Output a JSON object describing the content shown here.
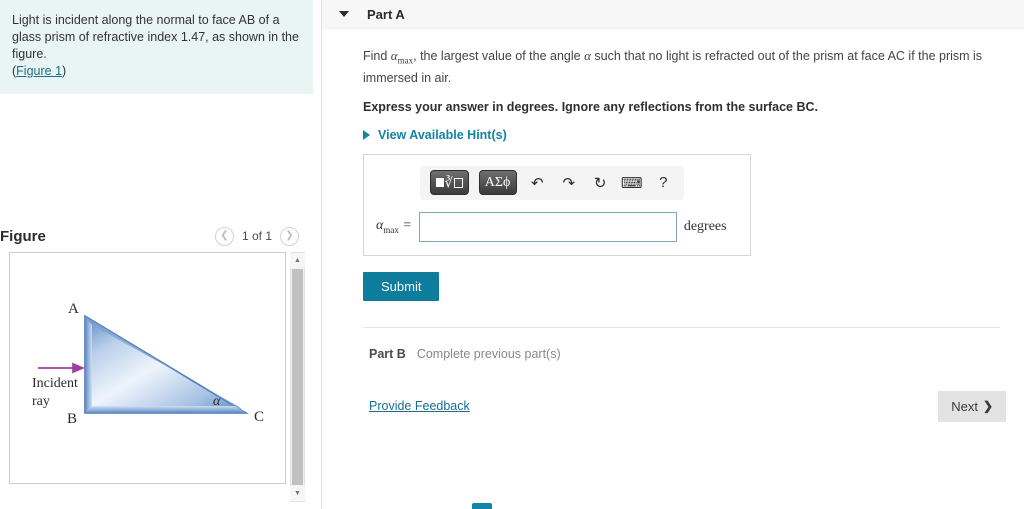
{
  "problem": {
    "text_line1": "Light is incident along the normal to face AB of a glass",
    "text_line2": "prism of refractive index 1.47, as shown in the figure.",
    "paren_open": "(",
    "figure_link": "Figure 1",
    "paren_close": ")"
  },
  "figure_panel": {
    "title": "Figure",
    "pager": {
      "prev_icon": "chevron-left-icon",
      "count_label": "1 of 1",
      "next_icon": "chevron-right-icon"
    },
    "scrollbar": {
      "up_icon": "triangle-up-icon",
      "down_icon": "triangle-down-icon"
    },
    "diagram": {
      "vertex_a": "A",
      "vertex_b": "B",
      "vertex_c": "C",
      "angle_label": "α",
      "ray_label_line1": "Incident",
      "ray_label_line2": "ray",
      "ray_color": "#9b3fa0",
      "prism_edge_color": "#5b86c4",
      "prism_fill_light": "#eaf1fb"
    }
  },
  "part_a": {
    "caret_icon": "caret-down-icon",
    "label": "Part A",
    "question_prefix": "Find ",
    "question_symbol": "α",
    "question_symbol_sub": "max",
    "question_mid": ", the largest value of the angle ",
    "question_symbol2": "α",
    "question_suffix": " such that no light is refracted out of the prism at face AC if the prism is immersed in air.",
    "instruction": "Express your answer in degrees. Ignore any reflections from the surface BC.",
    "hint_link": "View Available Hint(s)",
    "hint_caret_icon": "caret-right-icon",
    "toolbar": {
      "template_button": "math-template-button",
      "greek_button": "ΑΣϕ",
      "undo_icon": "undo-arrow-icon",
      "redo_icon": "redo-arrow-icon",
      "reset_icon": "reset-circle-icon",
      "keyboard_icon": "keyboard-icon",
      "help_icon": "?"
    },
    "answer": {
      "variable": "α",
      "variable_sub": "max",
      "equals": "=",
      "value": "",
      "placeholder": "",
      "units": "degrees"
    },
    "submit_label": "Submit"
  },
  "part_b": {
    "label": "Part B",
    "status": "Complete previous part(s)"
  },
  "footer": {
    "feedback_label": "Provide Feedback",
    "next_label": "Next",
    "next_chevron": "❯"
  },
  "colors": {
    "accent_teal": "#0e7c9b",
    "link_teal": "#1a6e8e",
    "statement_bg": "#e9f5f3",
    "part_header_bg": "#f7f7f7"
  }
}
